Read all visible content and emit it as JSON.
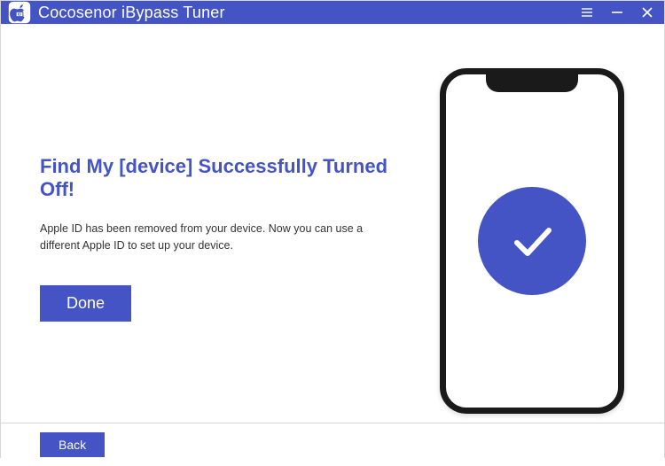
{
  "app": {
    "title": "Cocosenor iBypass Tuner"
  },
  "colors": {
    "accent": "#4454c4"
  },
  "main": {
    "headline": "Find My [device] Successfully Turned Off!",
    "description": "Apple ID has been removed from your device. Now you can use a different Apple ID to set up your device.",
    "done_label": "Done"
  },
  "footer": {
    "back_label": "Back"
  },
  "icons": {
    "logo": "apple-id-logo",
    "menu": "menu-icon",
    "minimize": "minimize-icon",
    "close": "close-icon",
    "check": "checkmark-icon"
  }
}
